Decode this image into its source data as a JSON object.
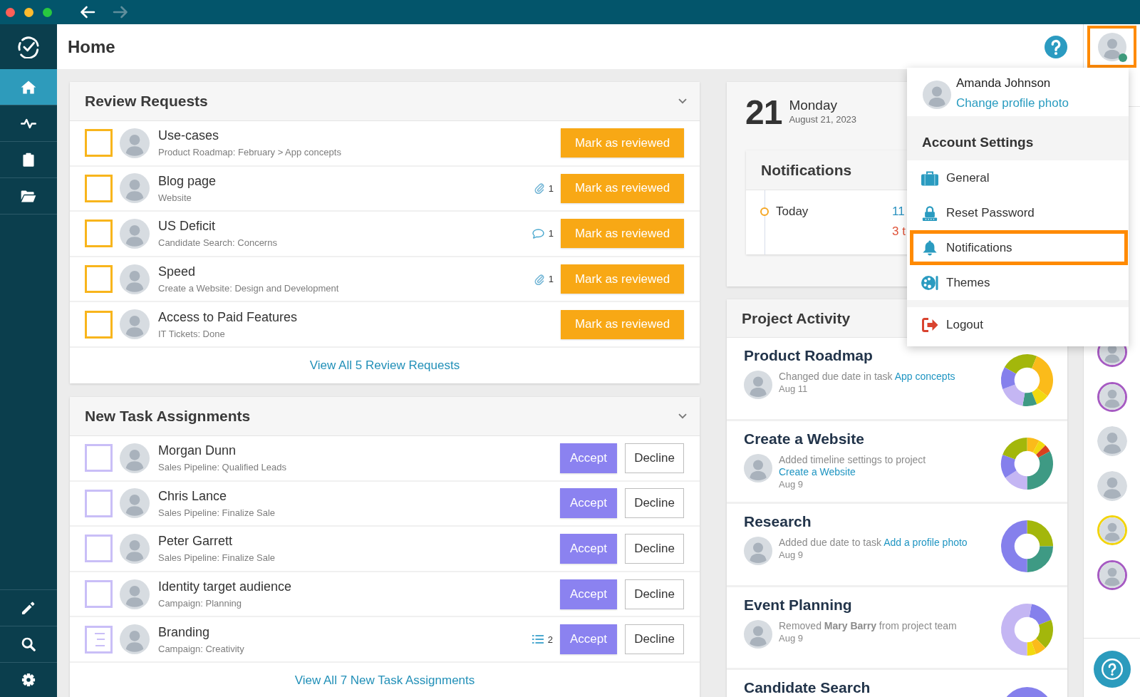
{
  "nav_buttons": [
    {
      "disabled": false
    },
    {
      "disabled": true
    }
  ],
  "sidebar": {
    "items": [
      {
        "selected": true
      },
      {
        "selected": false
      },
      {
        "selected": false
      },
      {
        "selected": false
      }
    ]
  },
  "header": {
    "title": "Home",
    "user": {
      "online": true,
      "highlighted": true
    }
  },
  "account_menu": {
    "name": "Amanda Johnson",
    "photo_link": "Change profile photo",
    "section_title": "Account Settings",
    "items": [
      {
        "label": "General",
        "highlighted": false
      },
      {
        "label": "Reset Password",
        "highlighted": false
      },
      {
        "label": "Notifications",
        "highlighted": true
      },
      {
        "label": "Themes",
        "highlighted": false
      }
    ],
    "footer_items": [
      {
        "label": "Logout",
        "highlighted": false
      }
    ]
  },
  "review_requests": {
    "title": "Review Requests",
    "items": [
      {
        "title": "Use-cases",
        "subtitle": "Product Roadmap: February > App concepts",
        "checked": false,
        "button": "Mark as reviewed"
      },
      {
        "title": "Blog page",
        "subtitle": "Website",
        "checked": false,
        "meta": {
          "kind": "attachment",
          "count": "1"
        },
        "button": "Mark as reviewed"
      },
      {
        "title": "US Deficit",
        "subtitle": "Candidate Search: Concerns",
        "checked": false,
        "meta": {
          "kind": "comment",
          "count": "1"
        },
        "button": "Mark as reviewed"
      },
      {
        "title": "Speed",
        "subtitle": "Create a Website: Design and Development",
        "checked": false,
        "meta": {
          "kind": "attachment",
          "count": "1"
        },
        "button": "Mark as reviewed"
      },
      {
        "title": "Access to Paid Features",
        "subtitle": "IT Tickets: Done",
        "checked": false,
        "button": "Mark as reviewed"
      }
    ],
    "footer_link": "View All 5 Review Requests"
  },
  "task_assignments": {
    "title": "New Task Assignments",
    "items": [
      {
        "title": "Morgan Dunn",
        "subtitle": "Sales Pipeline: Qualified Leads",
        "kind": "task",
        "checked": false,
        "accept": "Accept",
        "decline": "Decline"
      },
      {
        "title": "Chris Lance",
        "subtitle": "Sales Pipeline: Finalize Sale",
        "kind": "task",
        "checked": false,
        "accept": "Accept",
        "decline": "Decline"
      },
      {
        "title": "Peter Garrett",
        "subtitle": "Sales Pipeline: Finalize Sale",
        "kind": "task",
        "checked": false,
        "accept": "Accept",
        "decline": "Decline"
      },
      {
        "title": "Identity target audience",
        "subtitle": "Campaign: Planning",
        "kind": "task",
        "checked": false,
        "accept": "Accept",
        "decline": "Decline"
      },
      {
        "title": "Branding",
        "subtitle": "Campaign: Creativity",
        "kind": "list",
        "meta": {
          "kind": "subtasks",
          "count": "2"
        },
        "accept": "Accept",
        "decline": "Decline"
      }
    ],
    "footer_link": "View All 7 New Task Assignments"
  },
  "calendar": {
    "day": "21",
    "weekday": "Monday",
    "date": "August 21, 2023",
    "notifications": {
      "title": "Notifications",
      "entries": [
        {
          "label": "Today",
          "line_1": "11",
          "line_2": "3 t"
        }
      ]
    }
  },
  "project_activity": {
    "title": "Project Activity",
    "items": [
      {
        "project": "Product Roadmap",
        "text": "Changed due date in task",
        "link": "App concepts",
        "date": "Aug 11"
      },
      {
        "project": "Create a Website",
        "text": "Added timeline settings to project",
        "link": "Create a Website",
        "date": "Aug 9"
      },
      {
        "project": "Research",
        "text": "Added due date to task",
        "link": "Add a profile photo",
        "date": "Aug 9"
      },
      {
        "project": "Event Planning",
        "text": "Removed **Mary Barry** from project team",
        "date": "Aug 9"
      },
      {
        "project": "Candidate Search"
      }
    ]
  },
  "team": [
    {
      "ring": true,
      "color": "#a65bc2"
    },
    {
      "ring": true,
      "color": "#a65bc2"
    },
    {
      "ring": false
    },
    {
      "ring": false
    },
    {
      "ring": true,
      "color": "#f2d40c"
    },
    {
      "ring": true,
      "color": "#a65bc2"
    }
  ]
}
